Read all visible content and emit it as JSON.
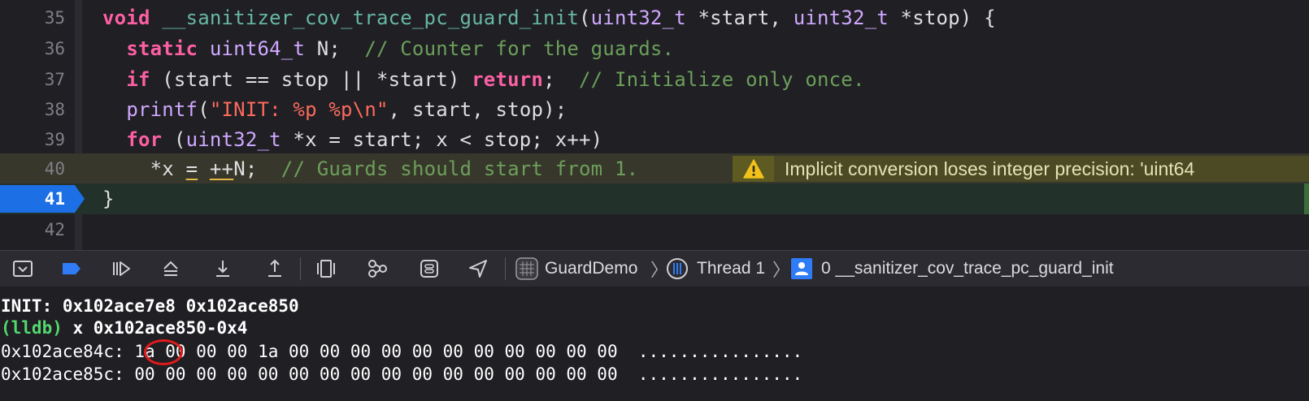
{
  "editor": {
    "lines": [
      {
        "num": "35"
      },
      {
        "num": "36"
      },
      {
        "num": "37"
      },
      {
        "num": "38"
      },
      {
        "num": "39"
      },
      {
        "num": "40"
      },
      {
        "num": "41"
      },
      {
        "num": "42"
      }
    ],
    "l35": {
      "void": "void",
      "fn": "__sanitizer_cov_trace_pc_guard_init",
      "p1": "(",
      "t1": "uint32_t",
      "a1": " *start, ",
      "t2": "uint32_t",
      "a2": " *stop) {"
    },
    "l36": {
      "indent": "  ",
      "kw": "static",
      "sp": " ",
      "ty": "uint64_t",
      "rest": " N;  ",
      "cm": "// Counter for the guards."
    },
    "l37": {
      "indent": "  ",
      "kw": "if",
      "mid": " (start == stop || *start) ",
      "kw2": "return",
      "semi": ";  ",
      "cm": "// Initialize only once."
    },
    "l38": {
      "indent": "  ",
      "fn": "printf",
      "p": "(",
      "s1": "\"INIT: ",
      "f1": "%p",
      "s2": " ",
      "f2": "%p",
      "f3": "\\n",
      "s3": "\"",
      "rest": ", start, stop);"
    },
    "l39": {
      "indent": "  ",
      "kw": "for",
      "p": " (",
      "ty": "uint32_t",
      "rest": " *x = start; x < stop; x++)"
    },
    "l40": {
      "indent": "    ",
      "a": "*x ",
      "eq": "=",
      "sp": " ",
      "inc": "++",
      "b": "N;  ",
      "cm": "// Guards should start from 1."
    },
    "l41": {
      "code": "}"
    },
    "warning": {
      "icon": "warning-triangle-icon",
      "text": "Implicit conversion loses integer precision: 'uint64"
    }
  },
  "toolbar": {
    "buttons": [
      "hide-console-icon",
      "breakpoints-icon",
      "continue-icon",
      "step-over-icon",
      "step-into-icon",
      "step-out-icon",
      "view-hierarchy-icon",
      "memory-graph-icon",
      "environment-overrides-icon",
      "simulate-location-icon"
    ],
    "breadcrumb": {
      "app": "GuardDemo",
      "thread": "Thread 1",
      "frame": "0 __sanitizer_cov_trace_pc_guard_init"
    }
  },
  "console": {
    "line1": "INIT: 0x102ace7e8 0x102ace850",
    "prompt": "(lldb)",
    "command": " x 0x102ace850-0x4",
    "line3": "0x102ace84c: 1a 00 00 00 1a 00 00 00 00 00 00 00 00 00 00 00  ................",
    "line4": "0x102ace85c: 00 00 00 00 00 00 00 00 00 00 00 00 00 00 00 00  ................"
  },
  "colors": {
    "accent": "#1d6fe5",
    "keyword": "#fc5fa3",
    "comment": "#6c9f5a",
    "type": "#d0a8ff",
    "function": "#67b7a4",
    "string": "#fc6a5d",
    "highlight": "#e11b1b"
  }
}
